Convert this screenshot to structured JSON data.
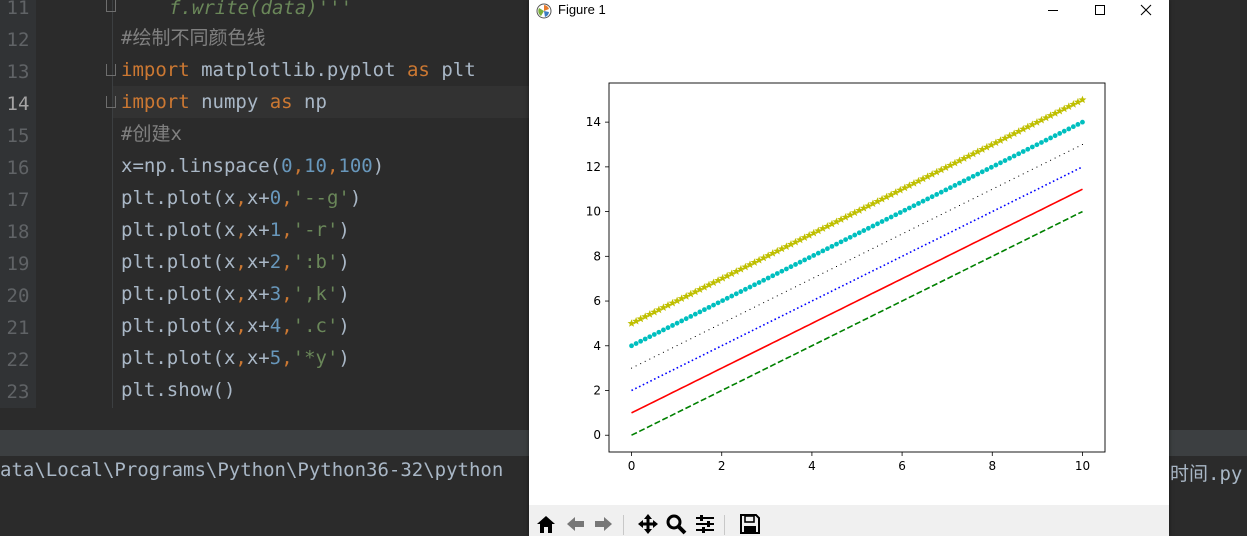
{
  "editor": {
    "line_numbers": [
      "11",
      "12",
      "13",
      "14",
      "15",
      "16",
      "17",
      "18",
      "19",
      "20",
      "21",
      "22",
      "23"
    ],
    "active_line": "14",
    "line11_code": "f.write(data)'''",
    "line12_comment": "#绘制不同颜色线",
    "line13": {
      "kw1": "import",
      "mod": " matplotlib.pyplot ",
      "kw2": "as",
      "alias": " plt"
    },
    "line14": {
      "kw1": "import",
      "mod": " numpy ",
      "kw2": "as",
      "alias": " np"
    },
    "line15_comment": "#创建x",
    "line16": {
      "a": "x=np.linspace(",
      "n1": "0",
      "n2": "10",
      "n3": "100",
      "b": ")"
    },
    "plot_lines": [
      {
        "offset": "0",
        "fmt": "'--g'"
      },
      {
        "offset": "1",
        "fmt": "'-r'"
      },
      {
        "offset": "2",
        "fmt": "':b'"
      },
      {
        "offset": "3",
        "fmt": "',k'"
      },
      {
        "offset": "4",
        "fmt": "'.c'"
      },
      {
        "offset": "5",
        "fmt": "'*y'"
      }
    ],
    "plot_prefix": "plt.plot(x",
    "plot_mid": "x+",
    "plot_suffix": ")",
    "comma": ",",
    "line23_code": "plt.show()"
  },
  "run_output": {
    "path_text": "ata\\Local\\Programs\\Python\\Python36-32\\python",
    "right_text": "时间.py"
  },
  "figure_window": {
    "title": "Figure 1",
    "minimize_icon": "minimize-icon",
    "maximize_icon": "maximize-icon",
    "close_icon": "close-icon"
  },
  "toolbar": {
    "buttons": [
      "home-icon",
      "back-icon",
      "forward-icon",
      "pan-icon",
      "zoom-icon",
      "configure-subplots-icon",
      "save-icon"
    ]
  },
  "chart_data": {
    "type": "line",
    "title": "",
    "xlabel": "",
    "ylabel": "",
    "xlim": [
      -0.5,
      10.5
    ],
    "ylim": [
      -0.75,
      15.75
    ],
    "xticks": [
      0,
      2,
      4,
      6,
      8,
      10
    ],
    "yticks": [
      0,
      2,
      4,
      6,
      8,
      10,
      12,
      14
    ],
    "x_range": [
      0,
      10
    ],
    "num_points": 100,
    "grid": false,
    "series": [
      {
        "offset": 0,
        "style": "dashed",
        "color": "#008000",
        "marker": "none"
      },
      {
        "offset": 1,
        "style": "solid",
        "color": "#ff0000",
        "marker": "none"
      },
      {
        "offset": 2,
        "style": "dotted",
        "color": "#0000ff",
        "marker": "none"
      },
      {
        "offset": 3,
        "style": "none",
        "color": "#000000",
        "marker": "pixel"
      },
      {
        "offset": 4,
        "style": "none",
        "color": "#00bfbf",
        "marker": "point"
      },
      {
        "offset": 5,
        "style": "none",
        "color": "#bfbf00",
        "marker": "star"
      }
    ]
  }
}
